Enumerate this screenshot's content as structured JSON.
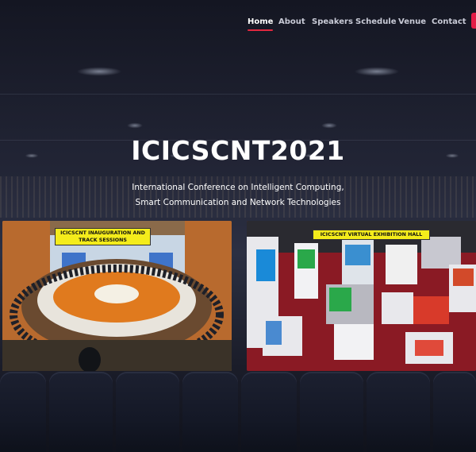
{
  "nav": {
    "items": [
      {
        "label": "Home",
        "active": true
      },
      {
        "label": "About"
      },
      {
        "label": "Speakers"
      },
      {
        "label": "Schedule"
      },
      {
        "label": "Venue"
      },
      {
        "label": "Contact"
      }
    ],
    "accent_color": "#e0283f"
  },
  "hero": {
    "title": "ICICSCNT2021",
    "subtitle_line1": "International Conference on Intelligent Computing,",
    "subtitle_line2": "Smart Communication and Network Technologies"
  },
  "cards": {
    "left": {
      "label_line1": "ICICSCNT INAUGURATION AND",
      "label_line2": "TRACK SESSIONS"
    },
    "right": {
      "label": "ICICSCNT VIRTUAL EXHIBITION HALL"
    },
    "label_color": "#f4ec1b"
  }
}
